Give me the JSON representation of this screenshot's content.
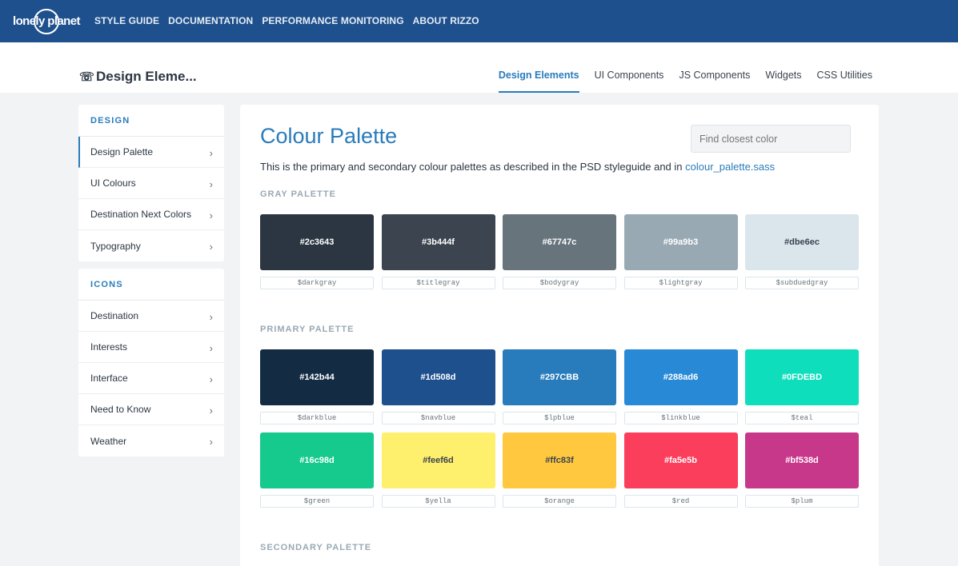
{
  "topbar": {
    "logo": "lonely planet",
    "nav": [
      "STYLE GUIDE",
      "DOCUMENTATION",
      "PERFORMANCE MONITORING",
      "ABOUT RIZZO"
    ]
  },
  "subbar": {
    "title": "Design Eleme...",
    "tabs": [
      {
        "label": "Design Elements",
        "active": true
      },
      {
        "label": "UI Components",
        "active": false
      },
      {
        "label": "JS Components",
        "active": false
      },
      {
        "label": "Widgets",
        "active": false
      },
      {
        "label": "CSS Utilities",
        "active": false
      }
    ]
  },
  "sidebar": {
    "design": {
      "heading": "DESIGN",
      "items": [
        "Design Palette",
        "UI Colours",
        "Destination Next Colors",
        "Typography"
      ]
    },
    "icons": {
      "heading": "ICONS",
      "items": [
        "Destination",
        "Interests",
        "Interface",
        "Need to Know",
        "Weather"
      ]
    }
  },
  "main": {
    "title": "Colour Palette",
    "finder_placeholder": "Find closest color",
    "desc_text": "This is the primary and secondary colour palettes as described in the PSD styleguide and in ",
    "desc_link": "colour_palette.sass",
    "gray_heading": "GRAY PALETTE",
    "primary_heading": "PRIMARY PALETTE",
    "secondary_heading": "SECONDARY PALETTE",
    "gray": [
      {
        "hex": "#2c3643",
        "var": "$darkgray",
        "color": "#2c3643",
        "text": "#ffffff"
      },
      {
        "hex": "#3b444f",
        "var": "$titlegray",
        "color": "#3b444f",
        "text": "#ffffff"
      },
      {
        "hex": "#67747c",
        "var": "$bodygray",
        "color": "#67747c",
        "text": "#ffffff"
      },
      {
        "hex": "#99a9b3",
        "var": "$lightgray",
        "color": "#99a9b3",
        "text": "#ffffff"
      },
      {
        "hex": "#dbe6ec",
        "var": "$subduedgray",
        "color": "#dbe6ec",
        "text": "#3b444f"
      }
    ],
    "primary_row1": [
      {
        "hex": "#142b44",
        "var": "$darkblue",
        "color": "#142b44",
        "text": "#ffffff"
      },
      {
        "hex": "#1d508d",
        "var": "$navblue",
        "color": "#1d508d",
        "text": "#ffffff"
      },
      {
        "hex": "#297CBB",
        "var": "$lpblue",
        "color": "#297cbb",
        "text": "#ffffff"
      },
      {
        "hex": "#288ad6",
        "var": "$linkblue",
        "color": "#288ad6",
        "text": "#ffffff"
      },
      {
        "hex": "#0FDEBD",
        "var": "$teal",
        "color": "#0fdebd",
        "text": "#ffffff"
      }
    ],
    "primary_row2": [
      {
        "hex": "#16c98d",
        "var": "$green",
        "color": "#16c98d",
        "text": "#ffffff"
      },
      {
        "hex": "#feef6d",
        "var": "$yella",
        "color": "#feef6d",
        "text": "#3b444f"
      },
      {
        "hex": "#ffc83f",
        "var": "$orange",
        "color": "#ffc83f",
        "text": "#3b444f"
      },
      {
        "hex": "#fa5e5b",
        "var": "$red",
        "color": "#fa3e5b",
        "text": "#ffffff"
      },
      {
        "hex": "#bf538d",
        "var": "$plum",
        "color": "#c8388a",
        "text": "#ffffff"
      }
    ]
  }
}
